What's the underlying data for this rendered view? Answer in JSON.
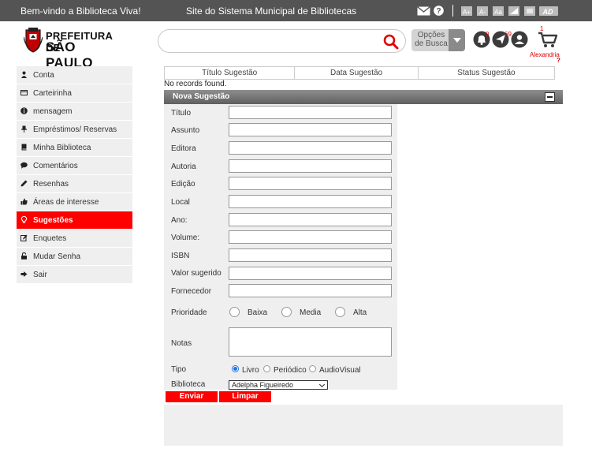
{
  "topbar": {
    "welcome": "Bem-vindo a Biblioteca Viva!",
    "site_title": "Site do Sistema Municipal de Bibliotecas",
    "icons": [
      "mail-icon",
      "help-icon",
      "font-increase-icon",
      "font-decrease-icon",
      "font-reset-icon",
      "contrast-icon",
      "grayscale-icon",
      "accessibility-icon"
    ]
  },
  "header": {
    "logo_line1": "PREFEITURA DE",
    "logo_line2": "SÃO PAULO",
    "search_value": "",
    "search_options_label": "Opções de Busca",
    "notifications_count": "0",
    "messages_count": "69",
    "cart_count": "1",
    "user_name": "Alexandria",
    "help_mark": "?"
  },
  "sidebar": {
    "items": [
      {
        "label": "Conta",
        "icon": "user-icon"
      },
      {
        "label": "Carteirinha",
        "icon": "card-icon"
      },
      {
        "label": "mensagem",
        "icon": "info-icon"
      },
      {
        "label": "Empréstimos/ Reservas",
        "icon": "pin-icon"
      },
      {
        "label": "Minha Biblioteca",
        "icon": "book-icon"
      },
      {
        "label": "Comentários",
        "icon": "comment-icon"
      },
      {
        "label": "Resenhas",
        "icon": "pencil-icon"
      },
      {
        "label": "Áreas de interesse",
        "icon": "thumbs-up-icon"
      },
      {
        "label": "Sugestões",
        "icon": "lightbulb-icon",
        "active": true
      },
      {
        "label": "Enquetes",
        "icon": "edit-icon"
      },
      {
        "label": "Mudar Senha",
        "icon": "lock-icon"
      },
      {
        "label": "Sair",
        "icon": "logout-icon"
      }
    ]
  },
  "suggestions_table": {
    "columns": [
      "Título Sugestão",
      "Data Sugestão",
      "Status Sugestão"
    ],
    "empty_message": "No records found."
  },
  "new_suggestion": {
    "title": "Nova Sugestão",
    "fields": {
      "titulo": "Título",
      "assunto": "Assunto",
      "editora": "Editora",
      "autoria": "Autoria",
      "edicao": "Edição",
      "local": "Local",
      "ano": "Ano:",
      "volume": "Volume:",
      "isbn": "ISBN",
      "valor": "Valor sugerido",
      "fornecedor": "Fornecedor",
      "prioridade": "Prioridade",
      "notas": "Notas",
      "tipo": "Tipo",
      "biblioteca": "Biblioteca"
    },
    "priority_options": [
      "Baixa",
      "Media",
      "Alta"
    ],
    "type_options": [
      "Livro",
      "Periódico",
      "AudioVisual"
    ],
    "type_selected": "Livro",
    "library_selected": "Adelpha Figueiredo",
    "submit_label": "Enviar",
    "clear_label": "Limpar"
  },
  "colors": {
    "accent": "#ff0000",
    "topbar": "#545454",
    "panel": "#efefef"
  }
}
